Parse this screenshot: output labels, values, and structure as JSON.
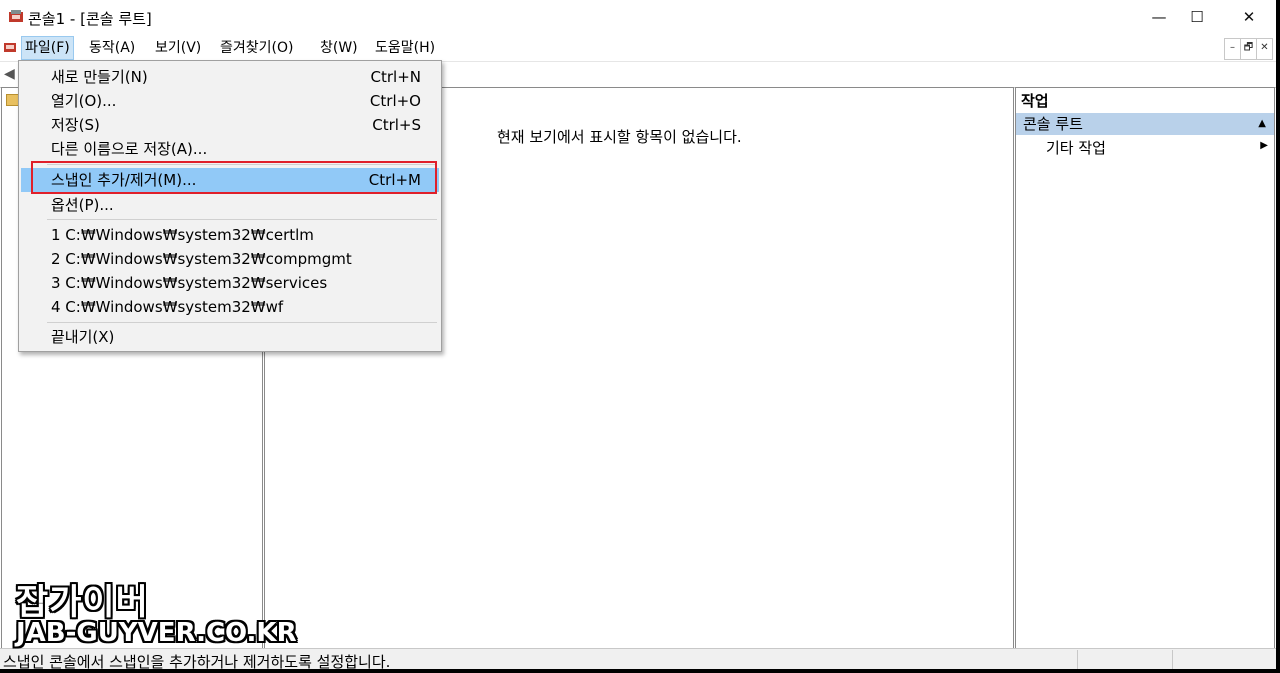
{
  "window": {
    "title": "콘솔1 - [콘솔 루트]",
    "minimize": "—",
    "maximize": "☐",
    "close": "✕"
  },
  "menubar": {
    "items": [
      "파일(F)",
      "동작(A)",
      "보기(V)",
      "즐겨찾기(O)",
      "창(W)",
      "도움말(H)"
    ],
    "mdi_minimize": "–",
    "mdi_restore": "🗗",
    "mdi_close": "✕"
  },
  "file_menu": {
    "new": {
      "label": "새로 만들기(N)",
      "shortcut": "Ctrl+N"
    },
    "open": {
      "label": "열기(O)...",
      "shortcut": "Ctrl+O"
    },
    "save": {
      "label": "저장(S)",
      "shortcut": "Ctrl+S"
    },
    "save_as": {
      "label": "다른 이름으로 저장(A)..."
    },
    "add_remove_snapin": {
      "label": "스냅인 추가/제거(M)...",
      "shortcut": "Ctrl+M"
    },
    "options": {
      "label": "옵션(P)..."
    },
    "recent": [
      "1 C:₩Windows₩system32₩certlm",
      "2 C:₩Windows₩system32₩compmgmt",
      "3 C:₩Windows₩system32₩services",
      "4 C:₩Windows₩system32₩wf"
    ],
    "exit": {
      "label": "끝내기(X)"
    }
  },
  "center": {
    "empty_message": "현재 보기에서 표시할 항목이 없습니다."
  },
  "actions": {
    "header": "작업",
    "group": "콘솔 루트",
    "item": "기타 작업"
  },
  "statusbar": {
    "text": "스냅인 콘솔에서 스냅인을 추가하거나 제거하도록 설정합니다."
  },
  "watermark": {
    "name": "잡가이버",
    "site": "JAB-GUYVER.CO.KR"
  },
  "colors": {
    "highlight": "#91c9f7",
    "callout": "#e0202a",
    "actions_group": "#b9d1ea"
  }
}
